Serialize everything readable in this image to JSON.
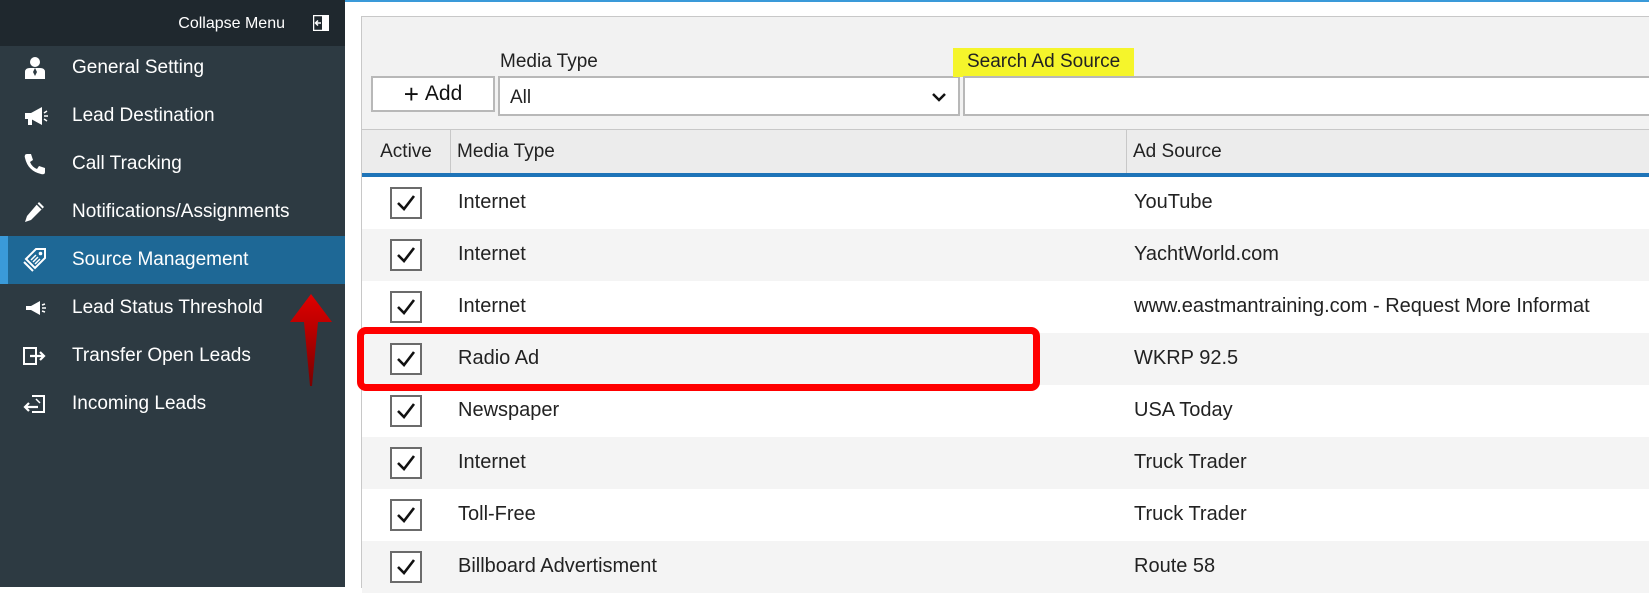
{
  "sidebar": {
    "collapse_label": "Collapse Menu",
    "items": [
      {
        "label": "General Setting",
        "icon": "user-icon"
      },
      {
        "label": "Lead Destination",
        "icon": "megaphone-icon"
      },
      {
        "label": "Call Tracking",
        "icon": "phone-icon"
      },
      {
        "label": "Notifications/Assignments",
        "icon": "pencil-icon"
      },
      {
        "label": "Source Management",
        "icon": "tag-icon",
        "active": true
      },
      {
        "label": "Lead Status Threshold",
        "icon": "megaphone-small-icon"
      },
      {
        "label": "Transfer Open Leads",
        "icon": "transfer-icon"
      },
      {
        "label": "Incoming Leads",
        "icon": "incoming-icon"
      }
    ]
  },
  "toolbar": {
    "add_label": "Add",
    "media_type_label": "Media Type",
    "media_type_value": "All",
    "search_label": "Search Ad Source",
    "search_value": ""
  },
  "grid": {
    "headers": {
      "active": "Active",
      "media_type": "Media Type",
      "ad_source": "Ad Source"
    },
    "rows": [
      {
        "active": true,
        "media_type": "Internet",
        "ad_source": "YouTube"
      },
      {
        "active": true,
        "media_type": "Internet",
        "ad_source": "YachtWorld.com"
      },
      {
        "active": true,
        "media_type": "Internet",
        "ad_source": "www.eastmantraining.com - Request More Informat"
      },
      {
        "active": true,
        "media_type": "Radio Ad",
        "ad_source": "WKRP 92.5"
      },
      {
        "active": true,
        "media_type": "Newspaper",
        "ad_source": "USA Today"
      },
      {
        "active": true,
        "media_type": "Internet",
        "ad_source": "Truck Trader"
      },
      {
        "active": true,
        "media_type": "Toll-Free",
        "ad_source": "Truck Trader"
      },
      {
        "active": true,
        "media_type": "Billboard Advertisment",
        "ad_source": "Route 58"
      }
    ]
  },
  "colors": {
    "sidebar_bg": "#2d3a42",
    "active_item_bg": "#1e6896",
    "accent": "#1e74b8",
    "highlight_label": "#f5f52b",
    "annotation_red": "#ff0000"
  }
}
